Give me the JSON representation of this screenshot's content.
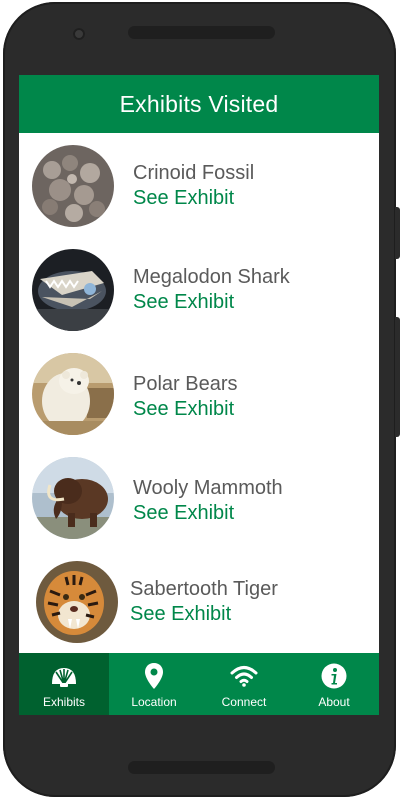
{
  "header": {
    "title": "Exhibits Visited"
  },
  "exhibits": [
    {
      "title": "Crinoid Fossil",
      "link": "See Exhibit",
      "image": "crinoid-fossil-photo"
    },
    {
      "title": "Megalodon Shark",
      "link": "See Exhibit",
      "image": "megalodon-shark-photo"
    },
    {
      "title": "Polar Bears",
      "link": "See Exhibit",
      "image": "polar-bear-photo"
    },
    {
      "title": "Wooly Mammoth",
      "link": "See Exhibit",
      "image": "wooly-mammoth-photo"
    },
    {
      "title": "Sabertooth Tiger",
      "link": "See Exhibit",
      "image": "sabertooth-tiger-photo"
    }
  ],
  "nav": {
    "active": "Exhibits",
    "items": [
      {
        "label": "Exhibits",
        "icon": "shell-icon"
      },
      {
        "label": "Location",
        "icon": "location-pin-icon"
      },
      {
        "label": "Connect",
        "icon": "wifi-icon"
      },
      {
        "label": "About",
        "icon": "info-icon"
      }
    ]
  },
  "colors": {
    "primary": "#00874a",
    "primary_dark": "#00612f",
    "text": "#5a5a5a"
  }
}
